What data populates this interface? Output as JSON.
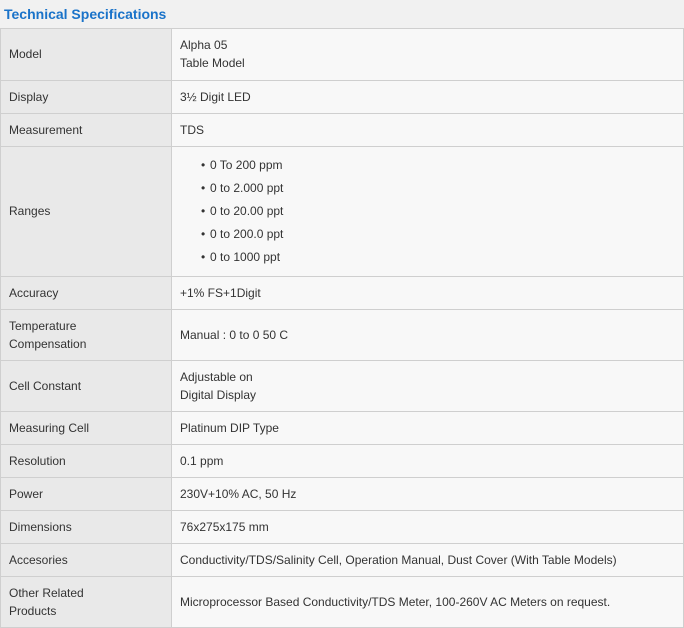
{
  "section_title": "Technical Specifications",
  "colors": {
    "title": "#1a73c9",
    "label_bg": "#e9e9e9",
    "value_bg": "#f8f8f8",
    "border": "#cfcfcf"
  },
  "rows": [
    {
      "label": "Model",
      "value": "Alpha 05\nTable Model"
    },
    {
      "label": "Display",
      "value": "3½ Digit LED"
    },
    {
      "label": "Measurement",
      "value": "TDS"
    },
    {
      "label": "Ranges",
      "items": [
        "0 To 200 ppm",
        "0 to 2.000 ppt",
        "0 to 20.00 ppt",
        "0 to 200.0 ppt",
        "0 to 1000 ppt"
      ]
    },
    {
      "label": "Accuracy",
      "value": "+1% FS+1Digit"
    },
    {
      "label": "Temperature\nCompensation",
      "value": "Manual : 0 to 0 50 C"
    },
    {
      "label": "Cell Constant",
      "value": "Adjustable on\nDigital Display"
    },
    {
      "label": "Measuring Cell",
      "value": "Platinum DIP Type"
    },
    {
      "label": "Resolution",
      "value": "0.1 ppm"
    },
    {
      "label": "Power",
      "value": "230V+10% AC, 50 Hz"
    },
    {
      "label": "Dimensions",
      "value": "76x275x175 mm"
    },
    {
      "label": "Accesories",
      "value": "Conductivity/TDS/Salinity Cell, Operation Manual, Dust Cover (With Table Models)"
    },
    {
      "label": "Other Related\nProducts",
      "value": "Microprocessor Based Conductivity/TDS Meter, 100-260V AC Meters on request."
    }
  ]
}
